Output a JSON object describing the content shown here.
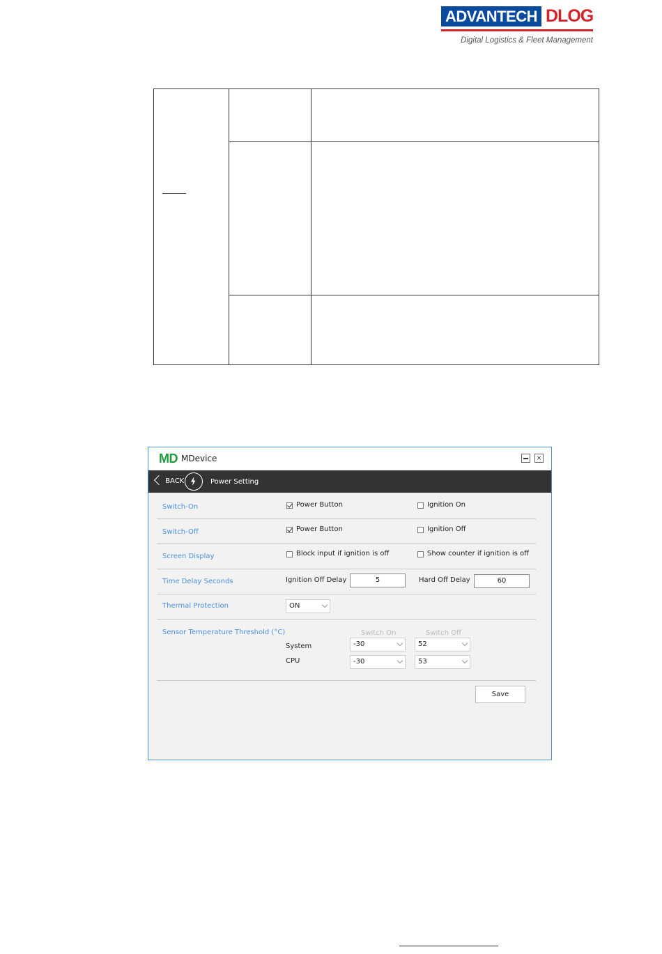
{
  "brand": {
    "advantech": "ADVANTECH",
    "dlog": "DLOG",
    "tagline": "Digital Logistics & Fleet Management",
    "accent_blue": "#0a4a9c",
    "accent_red": "#d2232a"
  },
  "window": {
    "app_logo": "MD",
    "title": "MDevice",
    "minimize_icon": "minimize-icon",
    "close_icon": "close-icon"
  },
  "nav": {
    "back_label": "BACK",
    "icon": "power-icon",
    "title": "Power Setting"
  },
  "settings": {
    "switch_on": {
      "label": "Switch-On",
      "opt1": {
        "label": "Power Button",
        "checked": true
      },
      "opt2": {
        "label": "Ignition On",
        "checked": false
      }
    },
    "switch_off": {
      "label": "Switch-Off",
      "opt1": {
        "label": "Power Button",
        "checked": true
      },
      "opt2": {
        "label": "Ignition Off",
        "checked": false
      }
    },
    "screen_display": {
      "label": "Screen Display",
      "opt1": {
        "label": "Block input if ignition is off",
        "checked": false
      },
      "opt2": {
        "label": "Show counter if ignition is off",
        "checked": false
      }
    },
    "time_delay": {
      "label": "Time Delay Seconds",
      "ignition_off_label": "Ignition Off Delay",
      "ignition_off_value": "5",
      "hard_off_label": "Hard Off Delay",
      "hard_off_value": "60"
    },
    "thermal": {
      "label": "Thermal Protection",
      "value": "ON"
    },
    "sensor": {
      "label": "Sensor Temperature Threshold (°C)",
      "col_on": "Switch On",
      "col_off": "Switch Off",
      "system_label": "System",
      "system_on": "-30",
      "system_off": "52",
      "cpu_label": "CPU",
      "cpu_on": "-30",
      "cpu_off": "53"
    },
    "save_label": "Save"
  }
}
